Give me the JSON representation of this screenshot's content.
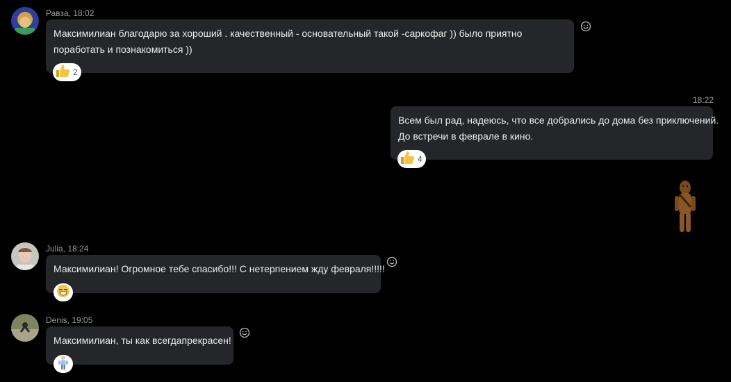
{
  "messages": [
    {
      "author": "Равза",
      "time": "18:02",
      "meta": "Равза, 18:02",
      "lines": [
        "Максимилиан  благодарю за  хороший . качественный - основательный такой -саркофаг )) было приятно",
        "поработать и познакомиться ))"
      ],
      "reaction": {
        "emoji": "thumbs-up",
        "count": "2"
      }
    },
    {
      "author": "",
      "time": "18:22",
      "lines": [
        "Всем был рад, надеюсь, что все добрались до дома без приключений.",
        "До встречи в феврале в кино."
      ],
      "reaction": {
        "emoji": "thumbs-up",
        "count": "4"
      },
      "sticker": "chewbacca-sticker"
    },
    {
      "author": "Julia",
      "time": "18:24",
      "meta": "Julia, 18:24",
      "lines": [
        "Максимилиан! Огромное тебе спасибо!!! С нетерпением жду февраля!!!!!"
      ],
      "reaction": {
        "emoji": "grinning-face"
      }
    },
    {
      "author": "Denis",
      "time": "19:05",
      "meta": "Denis, 19:05",
      "lines": [
        "Максимилиан, ты как всегдапрекрасен!"
      ],
      "reaction": {
        "emoji": "man-standing"
      }
    }
  ],
  "colors": {
    "background": "#000000",
    "bubble": "#242629",
    "meta_text": "#9a9a9a",
    "reaction_bg": "#ffffff"
  }
}
